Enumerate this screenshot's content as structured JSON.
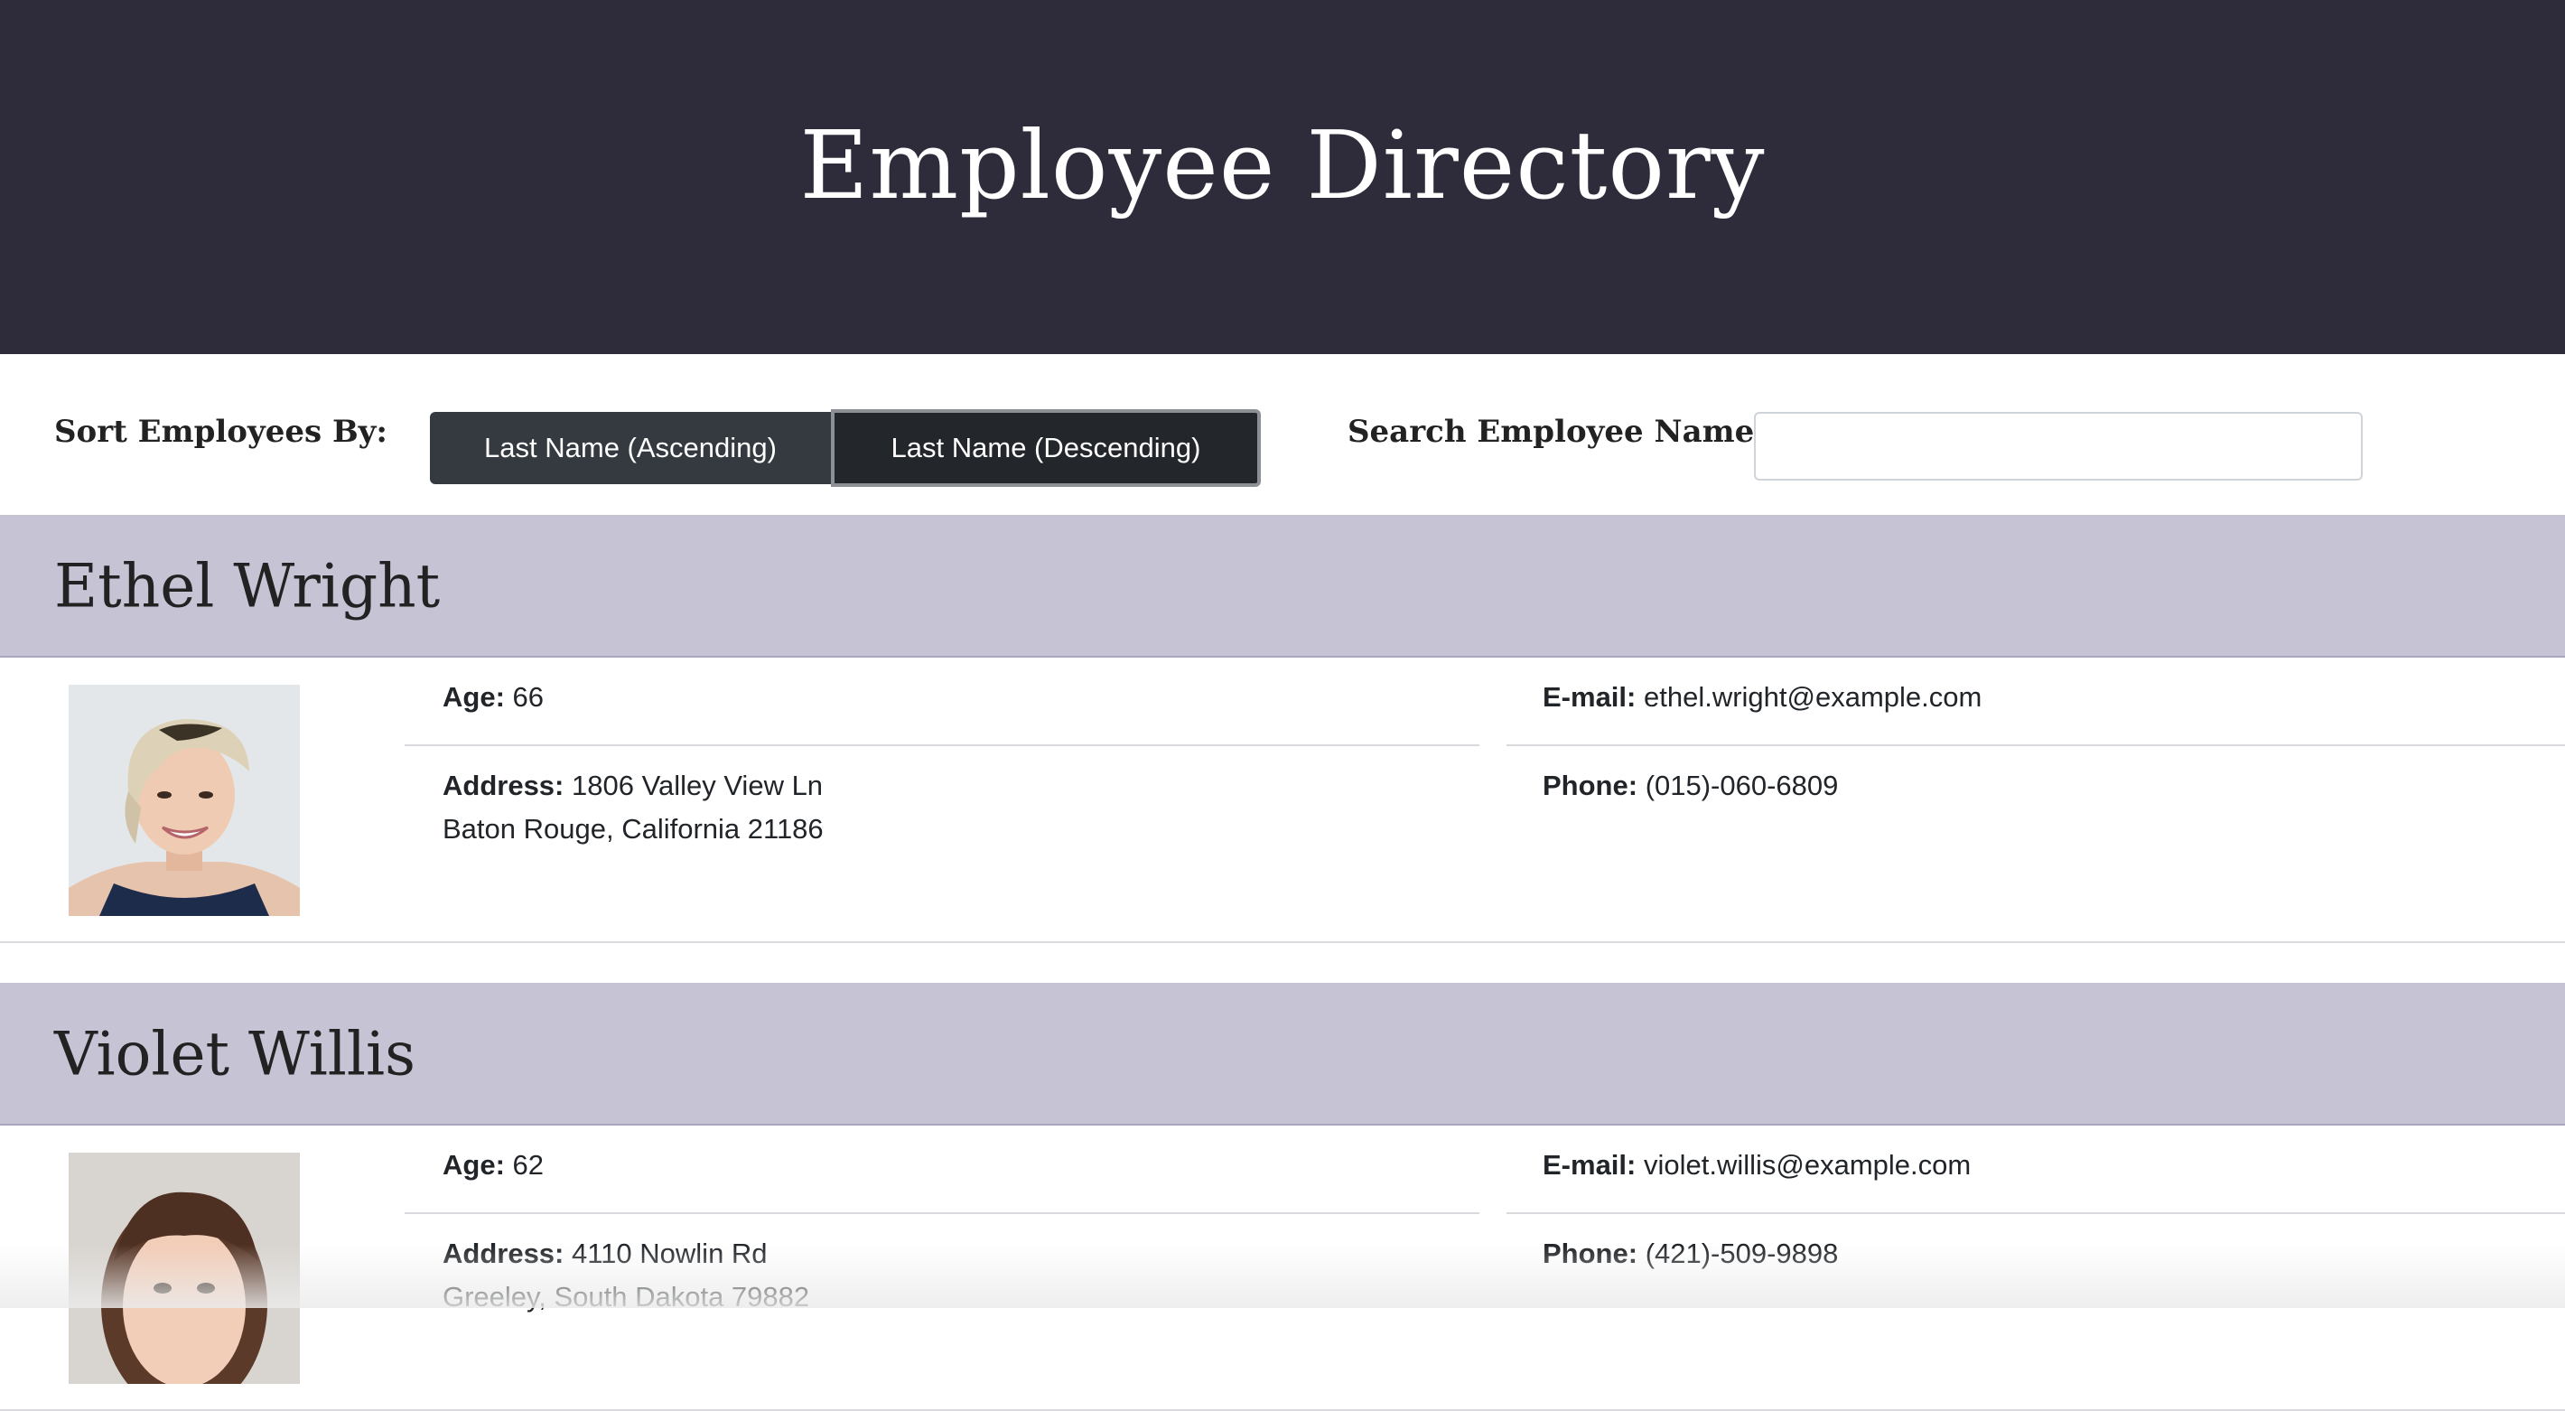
{
  "header": {
    "title": "Employee Directory"
  },
  "controls": {
    "sort_label": "Sort Employees By:",
    "sort_asc_label": "Last Name (Ascending)",
    "sort_desc_label": "Last Name (Descending)",
    "search_label": "Search Employee Name:",
    "search_value": ""
  },
  "employees": [
    {
      "name": "Ethel Wright",
      "age_label": "Age:",
      "age": "66",
      "address_label": "Address:",
      "address_line1": "1806 Valley View Ln",
      "address_line2": "Baton Rouge, California 21186",
      "email_label": "E-mail:",
      "email": "ethel.wright@example.com",
      "phone_label": "Phone:",
      "phone": "(015)-060-6809"
    },
    {
      "name": "Violet Willis",
      "age_label": "Age:",
      "age": "62",
      "address_label": "Address:",
      "address_line1": "4110 Nowlin Rd",
      "address_line2": "Greeley, South Dakota 79882",
      "email_label": "E-mail:",
      "email": "violet.willis@example.com",
      "phone_label": "Phone:",
      "phone": "(421)-509-9898"
    }
  ],
  "colors": {
    "header_bg": "#2e2c3a",
    "name_bar_bg": "#c6c3d5",
    "button_bg": "#343a40",
    "button_active_bg": "#23272b"
  }
}
